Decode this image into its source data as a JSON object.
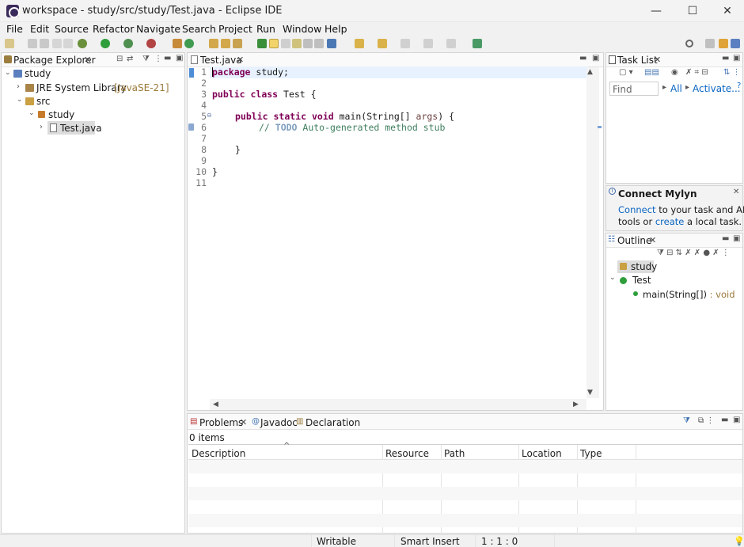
{
  "window": {
    "title": "workspace - study/src/study/Test.java - Eclipse IDE",
    "minimize_glyph": "—",
    "maximize_glyph": "☐",
    "close_glyph": "✕"
  },
  "menu": [
    "File",
    "Edit",
    "Source",
    "Refactor",
    "Navigate",
    "Search",
    "Project",
    "Run",
    "Window",
    "Help"
  ],
  "package_explorer": {
    "tab_label": "Package Explorer",
    "tree": {
      "project": "study",
      "jre": "JRE System Library",
      "jre_version": "[JavaSE-21]",
      "src": "src",
      "package": "study",
      "file": "Test.java"
    }
  },
  "editor": {
    "tab_label": "Test.java",
    "line_numbers": [
      "1",
      "2",
      "3",
      "4",
      "5",
      "6",
      "7",
      "8",
      "9",
      "10",
      "11"
    ],
    "code": {
      "l1_kw": "package",
      "l1_rest": " study;",
      "l3_kw1": "public",
      "l3_kw2": "class",
      "l3_rest": " Test {",
      "l5_kw1": "public",
      "l5_kw2": "static",
      "l5_kw3": "void",
      "l5_rest1": " main(String[] ",
      "l5_arg": "args",
      "l5_rest2": ") {",
      "l6_prefix": "// ",
      "l6_todo": "TODO",
      "l6_rest": " Auto-generated method stub",
      "l8": "}",
      "l10": "}"
    }
  },
  "task_list": {
    "tab_label": "Task List",
    "find_placeholder": "Find",
    "all_label": "All",
    "activate_label": "Activate...",
    "help_glyph": "?"
  },
  "mylyn": {
    "title": "Connect Mylyn",
    "connect_link": "Connect",
    "text1": " to your task and ALM",
    "text2": "tools or ",
    "create_link": "create",
    "text3": " a local task."
  },
  "outline": {
    "tab_label": "Outline",
    "package": "study",
    "class": "Test",
    "method": "main(String[])",
    "method_type": " : void"
  },
  "problems": {
    "tabs": {
      "problems": "Problems",
      "javadoc": "Javadoc",
      "declaration": "Declaration"
    },
    "count": "0 items",
    "columns": [
      "Description",
      "Resource",
      "Path",
      "Location",
      "Type"
    ]
  },
  "status": {
    "writable": "Writable",
    "insert_mode": "Smart Insert",
    "position": "1 : 1 : 0"
  },
  "colors": {
    "keyword": "#7f0055",
    "comment": "#3f7f5f",
    "link": "#0b65c2"
  }
}
